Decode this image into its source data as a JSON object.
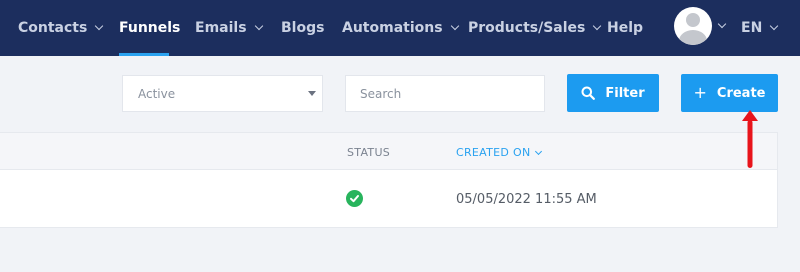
{
  "nav": {
    "items": [
      {
        "label": "Contacts",
        "dropdown": true,
        "active": false
      },
      {
        "label": "Funnels",
        "dropdown": false,
        "active": true
      },
      {
        "label": "Emails",
        "dropdown": true,
        "active": false
      },
      {
        "label": "Blogs",
        "dropdown": false,
        "active": false
      },
      {
        "label": "Automations",
        "dropdown": true,
        "active": false
      },
      {
        "label": "Products/Sales",
        "dropdown": true,
        "active": false
      },
      {
        "label": "Help",
        "dropdown": false,
        "active": false
      }
    ],
    "language": "EN"
  },
  "toolbar": {
    "status_select": "Active",
    "search_placeholder": "Search",
    "filter_label": "Filter",
    "create_label": "Create"
  },
  "table": {
    "columns": {
      "status": "STATUS",
      "created_on": "CREATED ON"
    },
    "rows": [
      {
        "status": "active",
        "created_on": "05/05/2022 11:55 AM"
      }
    ]
  },
  "colors": {
    "nav_bg": "#1c2e5e",
    "accent": "#1c9bf0",
    "status_ok": "#28b45d",
    "annotation": "#e8141b"
  }
}
